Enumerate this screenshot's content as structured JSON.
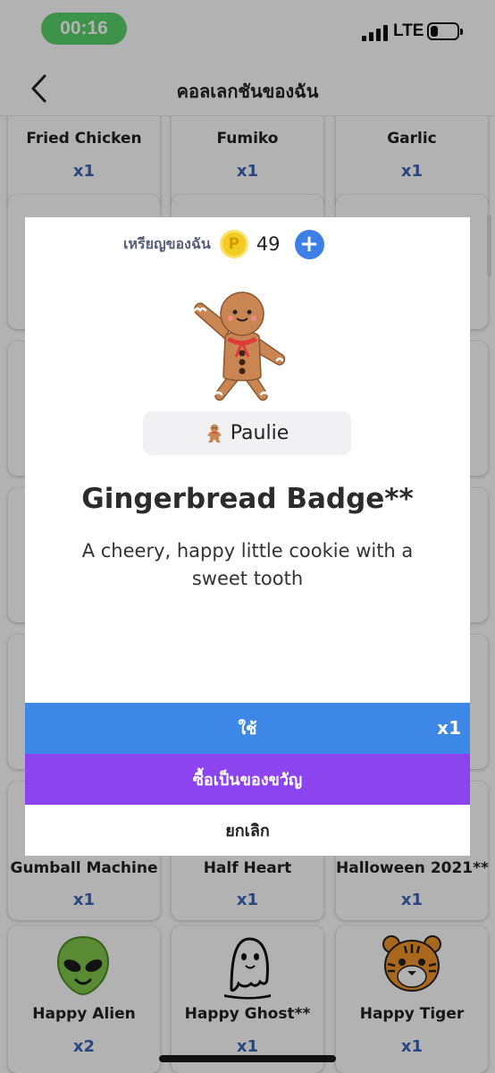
{
  "status_bar": {
    "time": "00:16",
    "network": "LTE",
    "battery_level": 0.3
  },
  "nav": {
    "title": "คอลเลกชันของฉัน",
    "back_icon": "chevron-left-icon"
  },
  "collection": {
    "rows": [
      [
        {
          "name": "Fried Chicken",
          "count": "x1"
        },
        {
          "name": "Fumiko",
          "count": "x1"
        },
        {
          "name": "Garlic",
          "count": "x1"
        }
      ],
      [
        {
          "name": "Gumball Machine",
          "count": "x1"
        },
        {
          "name": "Half Heart",
          "count": "x1"
        },
        {
          "name": "Halloween 2021**",
          "count": "x1"
        }
      ],
      [
        {
          "name": "Happy Alien",
          "count": "x2",
          "icon": "alien-icon"
        },
        {
          "name": "Happy Ghost**",
          "count": "x1",
          "icon": "ghost-icon"
        },
        {
          "name": "Happy Tiger",
          "count": "x1",
          "icon": "tiger-icon"
        }
      ]
    ]
  },
  "modal": {
    "coins_label": "เหรียญของฉัน",
    "coin_symbol": "P",
    "coins_value": "49",
    "add_icon": "plus-icon",
    "badge_icon": "gingerbread-icon",
    "owner_name": "Paulie",
    "badge_title": "Gingerbread Badge**",
    "badge_description": "A cheery, happy little cookie with a sweet tooth",
    "use_label": "ใช้",
    "use_count": "x1",
    "gift_label": "ซื้อเป็นของขวัญ",
    "cancel_label": "ยกเลิก",
    "colors": {
      "use": "#3d87e6",
      "gift": "#8b44ee",
      "add": "#3d7fe6",
      "coin": "#f4cc21",
      "count": "#3a66b8"
    }
  }
}
